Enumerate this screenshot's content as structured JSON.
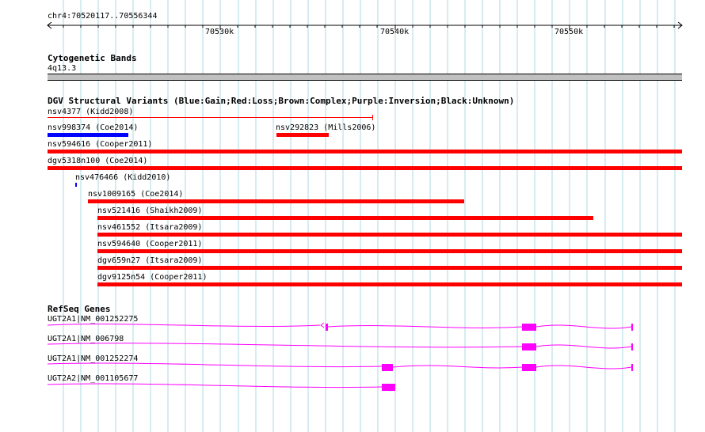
{
  "ruler": {
    "location": "chr4:70520117..70556344",
    "ticks": [
      "70530k",
      "70540k",
      "70550k"
    ]
  },
  "cytoband": {
    "title": "Cytogenetic Bands",
    "band": "4q13.3"
  },
  "dgv": {
    "title": "DGV Structural Variants (Blue:Gain;Red:Loss;Brown:Complex;Purple:Inversion;Black:Unknown)",
    "variants": [
      {
        "label": "nsv4377 (Kidd2008)",
        "type": "Loss",
        "color": "#ff0000"
      },
      {
        "label": "nsv998374 (Coe2014)",
        "type": "Gain",
        "color": "#0000ff"
      },
      {
        "label": "nsv292823 (Mills2006)",
        "type": "Loss",
        "color": "#ff0000"
      },
      {
        "label": "nsv594616 (Cooper2011)",
        "type": "Loss",
        "color": "#ff0000"
      },
      {
        "label": "dgv5318n100 (Coe2014)",
        "type": "Loss",
        "color": "#ff0000"
      },
      {
        "label": "nsv476466 (Kidd2010)",
        "type": "Gain",
        "color": "#0000ff"
      },
      {
        "label": "nsv1009165 (Coe2014)",
        "type": "Loss",
        "color": "#ff0000"
      },
      {
        "label": "nsv521416 (Shaikh2009)",
        "type": "Loss",
        "color": "#ff0000"
      },
      {
        "label": "nsv461552 (Itsara2009)",
        "type": "Loss",
        "color": "#ff0000"
      },
      {
        "label": "nsv594640 (Cooper2011)",
        "type": "Loss",
        "color": "#ff0000"
      },
      {
        "label": "dgv659n27 (Itsara2009)",
        "type": "Loss",
        "color": "#ff0000"
      },
      {
        "label": "dgv9125n54 (Cooper2011)",
        "type": "Loss",
        "color": "#ff0000"
      }
    ]
  },
  "refseq": {
    "title": "RefSeq Genes",
    "genes": [
      {
        "label": "UGT2A1|NM_001252275"
      },
      {
        "label": "UGT2A1|NM_006798"
      },
      {
        "label": "UGT2A1|NM_001252274"
      },
      {
        "label": "UGT2A2|NM_001105677"
      }
    ]
  },
  "colors": {
    "gridline": "#add8e6",
    "loss": "#ff0000",
    "gain": "#0000ff",
    "gene": "#ff00ff",
    "cytoband": "#c0c0c0"
  }
}
